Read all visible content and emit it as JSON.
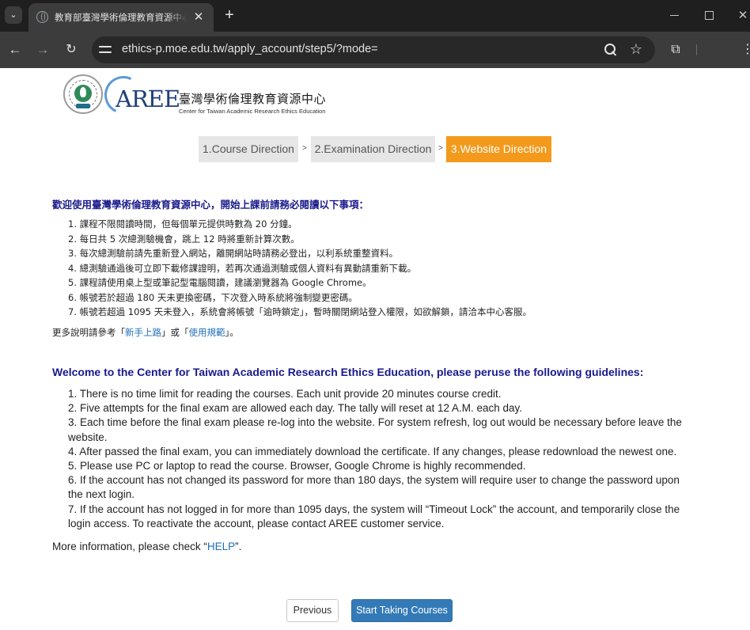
{
  "browser": {
    "tab_title": "教育部臺灣學術倫理教育資源中心",
    "url": "ethics-p.moe.edu.tw/apply_account/step5/?mode=",
    "icons": {
      "tab_search": "chevron-down-icon",
      "favicon": "globe-icon",
      "tab_close": "close-icon",
      "new_tab": "plus-icon",
      "back": "arrow-left-icon",
      "forward": "arrow-right-icon",
      "reload": "reload-icon",
      "site_info": "tune-icon",
      "zoom": "zoom-icon",
      "bookmark": "star-icon",
      "extensions": "puzzle-icon",
      "menu": "more-vert-icon"
    }
  },
  "logo": {
    "seal_text": "MINISTRY OF EDUCATION 教育部",
    "mark": "AREE",
    "title": "臺灣學術倫理教育資源中心",
    "subtitle": "Center for Taiwan Academic Research Ethics Education"
  },
  "steps": [
    {
      "label": "1.Course Direction",
      "active": false
    },
    {
      "label": "2.Examination Direction",
      "active": false
    },
    {
      "label": "3.Website Direction",
      "active": true
    }
  ],
  "step_separator": ">",
  "zh": {
    "heading": "歡迎使用臺灣學術倫理教育資源中心，開始上課前請務必閱讀以下事項：",
    "items": [
      "1. 課程不限閱讀時間，但每個單元提供時數為 20 分鐘。",
      "2. 每日共 5 次總測驗機會，跳上 12 時將重新計算次數。",
      "3. 每次總測驗前請先重新登入網站，離開網站時請務必登出，以利系統重整資料。",
      "4. 總測驗通過後可立即下載修課證明，若再次通過測驗或個人資料有異動請重新下載。",
      "5. 課程請使用桌上型或筆記型電腦閱讀，建議瀏覽器為 Google Chrome。",
      "6. 帳號若於超過 180 天未更換密碼，下次登入時系統將強制變更密碼。",
      "7. 帳號若超過 1095 天未登入，系統會將帳號「逾時鎖定」，暫時關閉網站登入權限，如欲解鎖，請洽本中心客服。"
    ],
    "more_prefix": "更多說明請參考「",
    "more_link1": "新手上路",
    "more_middle": "」或「",
    "more_link2": "使用規範",
    "more_suffix": "」。"
  },
  "en": {
    "heading": "Welcome to the Center for Taiwan Academic Research Ethics Education, please peruse the following guidelines:",
    "items": [
      "1. There is no time limit for reading the courses. Each unit provide 20 minutes course credit.",
      "2. Five attempts for the final exam are allowed each day. The tally will reset at 12 A.M. each day.",
      "3. Each time before the final exam please re-log into the website. For system refresh, log out would be necessary before leave the website.",
      "4. After passed the final exam, you can immediately download the certificate. If any changes, please redownload the newest one.",
      "5. Please use PC or laptop to read the course. Browser, Google Chrome is highly recommended.",
      "6. If the account has not changed its password for more than 180 days, the system will require user to change the password upon the next login.",
      "7. If the account has not logged in for more than 1095 days, the system will “Timeout Lock” the account, and temporarily close the login access. To reactivate the account, please contact AREE customer service."
    ],
    "more_prefix": "More information, please check “",
    "more_link": "HELP",
    "more_suffix": "”."
  },
  "buttons": {
    "previous": "Previous",
    "start": "Start Taking Courses"
  },
  "colors": {
    "active_step": "#f39a1c",
    "inactive_step": "#e6e6e6",
    "heading": "#1a1a8c",
    "link": "#1e6fb5",
    "primary_button": "#337ab7"
  }
}
